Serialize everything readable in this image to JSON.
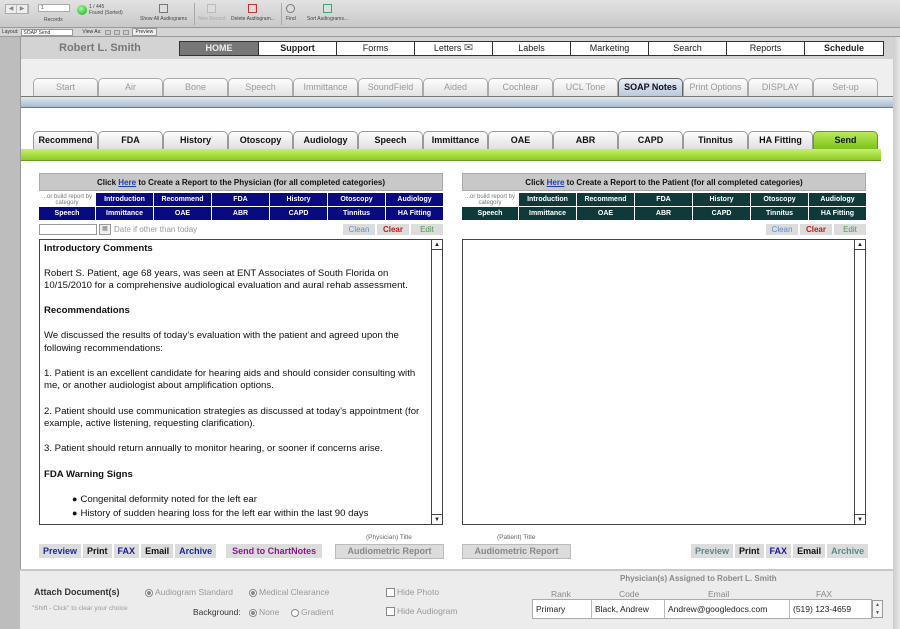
{
  "toolbar": {
    "record_value": "1",
    "records_label": "Records",
    "found_count": "1 / 445",
    "found_status": "Found (Sorted)",
    "show_all": "Show All Audiograms",
    "new_record": "New Record",
    "delete": "Delete Audiogram...",
    "find": "Find",
    "sort": "Sort Audiograms..."
  },
  "statusbar": {
    "layout_label": "Layout:",
    "layout_value": "SOAP Send",
    "view_as_label": "View As:",
    "preview_label": "Preview"
  },
  "header": {
    "patient_name": "Robert L. Smith",
    "topnav": [
      "HOME",
      "Support",
      "Forms",
      "Letters",
      "Labels",
      "Marketing",
      "Search",
      "Reports",
      "Schedule"
    ]
  },
  "tabs_main": [
    "Start",
    "Air",
    "Bone",
    "Speech",
    "Immittance",
    "SoundField",
    "Aided",
    "Cochlear",
    "UCL Tone",
    "SOAP Notes",
    "Print Options",
    "DISPLAY",
    "Set-up"
  ],
  "tabs_soap": [
    "Recommend",
    "FDA",
    "History",
    "Otoscopy",
    "Audiology",
    "Speech",
    "Immittance",
    "OAE",
    "ABR",
    "CAPD",
    "Tinnitus",
    "HA Fitting",
    "Send"
  ],
  "physician_panel": {
    "head_prefix": "Click ",
    "head_link": "Here",
    "head_suffix": " to Create a Report to the Physician (for all completed categories)",
    "build_label": "...or build report by category",
    "categories": [
      "Introduction",
      "Recommend",
      "FDA",
      "History",
      "Otoscopy",
      "Audiology",
      "Speech",
      "Immittance",
      "OAE",
      "ABR",
      "CAPD",
      "Tinnitus",
      "HA Fitting"
    ],
    "date_hint": "Date if other than today",
    "clean": "Clean",
    "clear": "Clear",
    "edit": "Edit",
    "content": {
      "h1": "Introductory Comments",
      "p1": "Robert S. Patient, age 68 years, was seen at ENT Associates of South Florida on 10/15/2010 for a comprehensive audiological evaluation and aural rehab assessment.",
      "h2": "Recommendations",
      "p2": "We discussed the results of today’s evaluation with the patient and agreed upon the following recommendations:",
      "p3": "1. Patient is an excellent candidate for hearing aids and should consider consulting with me, or another audiologist about amplification options.",
      "p4": "2. Patient should use communication strategies as discussed at today’s appointment (for example, active listening, requesting clarification).",
      "p5": "3. Patient should return annually to monitor hearing, or sooner if concerns arise.",
      "h3": "FDA Warning Signs",
      "bullets": [
        "Congenital deformity noted for the left ear",
        "History of sudden hearing loss for the left ear within the last 90 days"
      ]
    },
    "actions": [
      "Preview",
      "Print",
      "FAX",
      "Email",
      "Archive"
    ],
    "send_chartnotes": "Send to ChartNotes",
    "title_label": "(Physician) Title",
    "title_value": "Audiometric Report"
  },
  "patient_panel": {
    "head_prefix": "Click ",
    "head_link": "Here",
    "head_suffix": " to Create a Report to the Patient (for all completed categories)",
    "build_label": "...or build report by category",
    "categories": [
      "Introduction",
      "Recommend",
      "FDA",
      "History",
      "Otoscopy",
      "Audiology",
      "Speech",
      "Immittance",
      "OAE",
      "ABR",
      "CAPD",
      "Tinnitus",
      "HA Fitting"
    ],
    "clean": "Clean",
    "clear": "Clear",
    "edit": "Edit",
    "actions": [
      "Preview",
      "Print",
      "FAX",
      "Email",
      "Archive"
    ],
    "title_label": "(Patient) Title",
    "title_value": "Audiometric Report"
  },
  "attach": {
    "label": "Attach Document(s)",
    "hint": "\"Shift - Click\"  to clear your choice",
    "opt1": "Audiogram Standard",
    "opt2": "Medical Clearance",
    "background_label": "Background:",
    "bg_none": "None",
    "bg_gradient": "Gradient",
    "hide_photo": "Hide Photo",
    "hide_audiogram": "Hide Audiogram"
  },
  "physicians": {
    "title": "Physician(s) Assigned to Robert L. Smith",
    "headers": [
      "Rank",
      "Code",
      "Email",
      "FAX"
    ],
    "rows": [
      {
        "rank": "Primary",
        "code": "Black, Andrew",
        "email": "Andrew@googledocs.com",
        "fax": "(519) 123-4659"
      }
    ]
  }
}
